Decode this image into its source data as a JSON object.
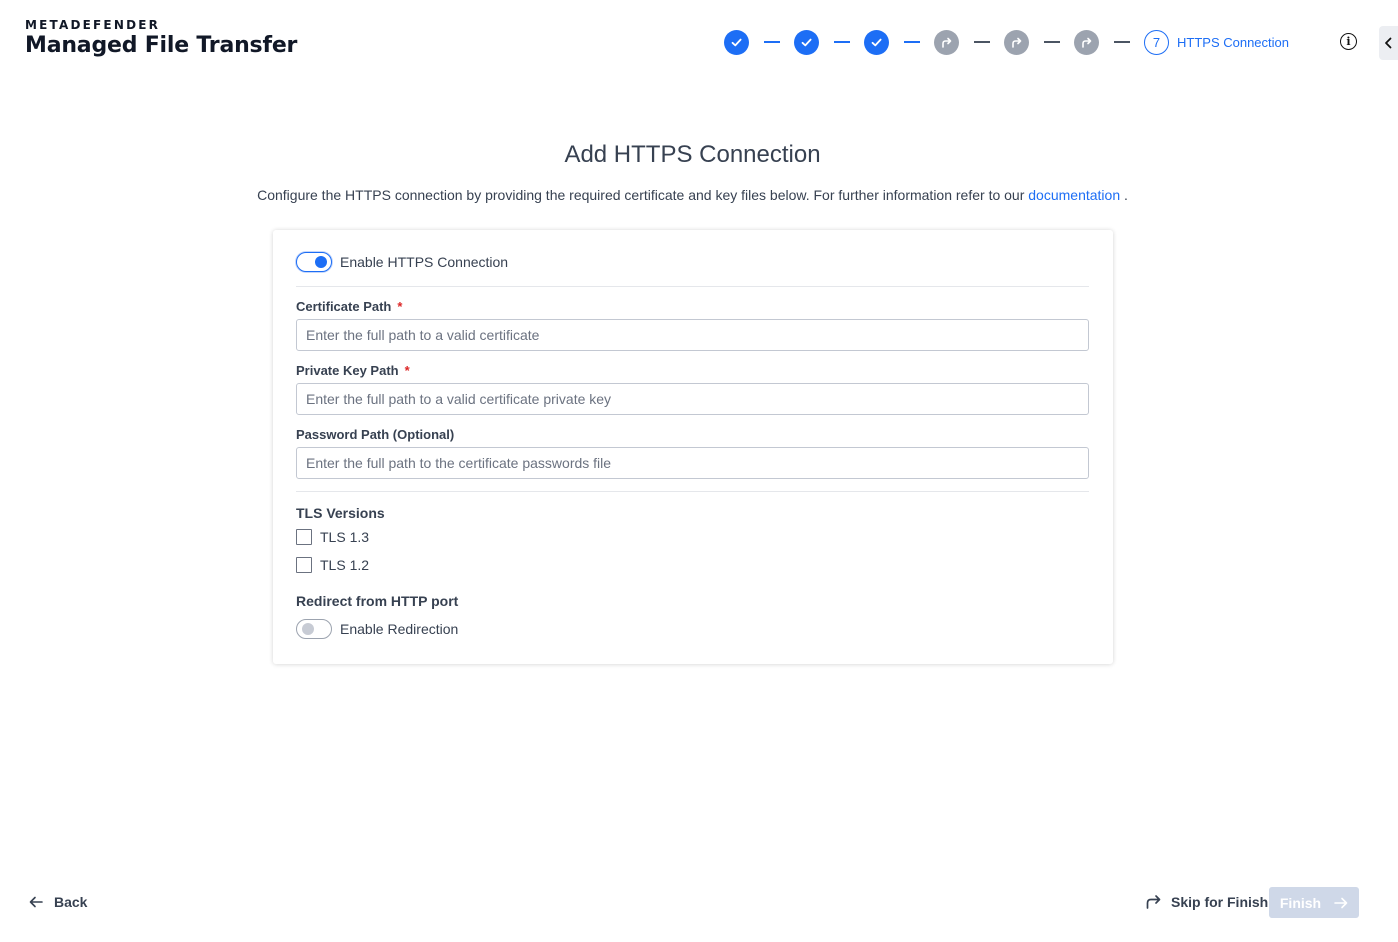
{
  "brand": {
    "top": "METADEFENDER",
    "main": "Managed File Transfer"
  },
  "stepper": {
    "steps": [
      {
        "state": "done",
        "icon": "check-icon"
      },
      {
        "state": "done",
        "icon": "check-icon"
      },
      {
        "state": "done",
        "icon": "check-icon"
      },
      {
        "state": "skipped",
        "icon": "skip-arrow-icon"
      },
      {
        "state": "skipped",
        "icon": "skip-arrow-icon"
      },
      {
        "state": "skipped",
        "icon": "skip-arrow-icon"
      }
    ],
    "current": {
      "number": "7",
      "label": "HTTPS Connection"
    }
  },
  "header": {
    "info_icon": "info-icon",
    "collapse_icon": "chevron-left-icon"
  },
  "page": {
    "title": "Add HTTPS Connection",
    "subtitle_prefix": "Configure the HTTPS connection by providing the required certificate and key files below. For further information refer to our",
    "subtitle_link": "documentation",
    "subtitle_suffix": "."
  },
  "form": {
    "enable_https": {
      "label": "Enable HTTPS Connection",
      "on": true
    },
    "certificate": {
      "label": "Certificate Path",
      "required_mark": "*",
      "value": "",
      "placeholder": "Enter the full path to a valid certificate"
    },
    "private_key": {
      "label": "Private Key Path",
      "required_mark": "*",
      "value": "",
      "placeholder": "Enter the full path to a valid certificate private key"
    },
    "password": {
      "label": "Password Path (Optional)",
      "value": "",
      "placeholder": "Enter the full path to the certificate passwords file"
    },
    "tls": {
      "title": "TLS Versions",
      "options": [
        {
          "label": "TLS 1.3",
          "checked": false
        },
        {
          "label": "TLS 1.2",
          "checked": false
        }
      ]
    },
    "redirect": {
      "title": "Redirect from HTTP port",
      "label": "Enable Redirection",
      "on": false
    }
  },
  "footer": {
    "back_label": "Back",
    "skip_label": "Skip for Finish",
    "finish_label": "Finish"
  },
  "colors": {
    "accent": "#1d6ef5",
    "skipped": "#9ca3af",
    "required": "#dc2626",
    "finish_disabled": "#cfd8e8"
  }
}
